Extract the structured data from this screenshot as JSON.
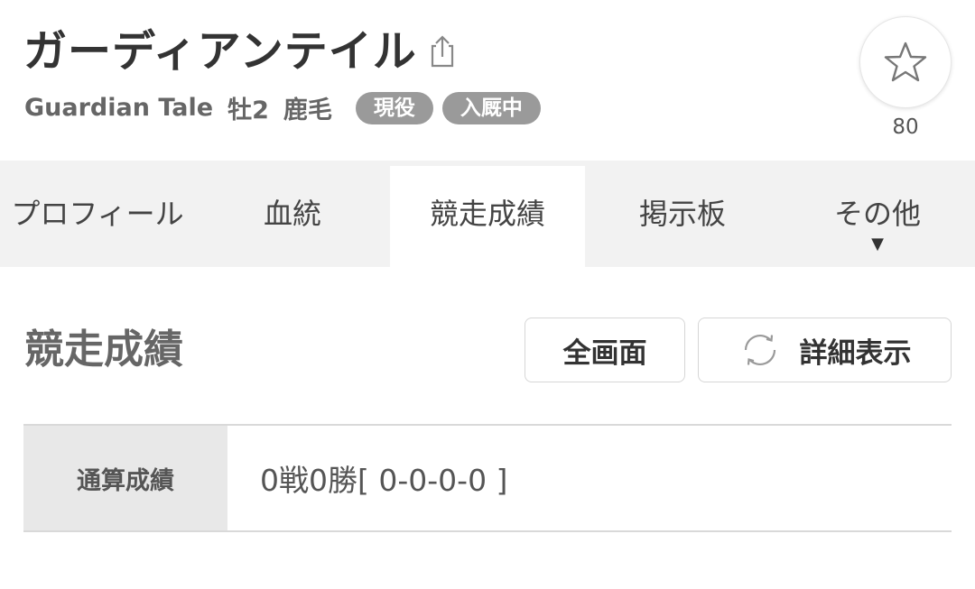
{
  "horse": {
    "name": "ガーディアンテイル",
    "english_name": "Guardian Tale",
    "sex_age": "牡2",
    "coat": "鹿毛",
    "badges": [
      "現役",
      "入厩中"
    ]
  },
  "favorite": {
    "count": "80",
    "icon": "star-icon"
  },
  "share": {
    "icon": "share-icon"
  },
  "tabs": [
    {
      "label": "プロフィール",
      "active": false
    },
    {
      "label": "血統",
      "active": false
    },
    {
      "label": "競走成績",
      "active": true
    },
    {
      "label": "掲示板",
      "active": false
    },
    {
      "label": "その他",
      "active": false,
      "dropdown": true
    }
  ],
  "section": {
    "title": "競走成績",
    "fullscreen_label": "全画面",
    "detail_label": "詳細表示",
    "detail_icon": "refresh-icon"
  },
  "record": {
    "label": "通算成績",
    "value": "0戦0勝[ 0-0-0-0 ]"
  },
  "colors": {
    "badge_bg": "#9a9a9a",
    "tab_bar_bg": "#f2f2f2",
    "record_label_bg": "#e8e8e8"
  }
}
